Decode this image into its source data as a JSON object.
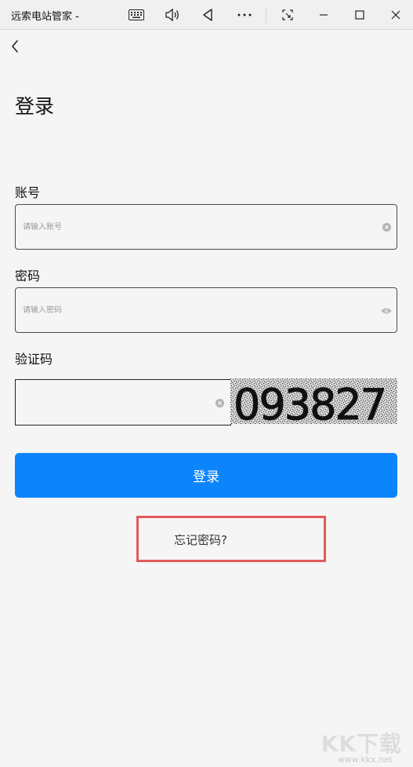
{
  "window": {
    "title": "远索电站管家 -"
  },
  "page": {
    "heading": "登录",
    "account": {
      "label": "账号",
      "placeholder": "请输入账号",
      "value": ""
    },
    "password": {
      "label": "密码",
      "placeholder": "请输入密码",
      "value": ""
    },
    "captcha": {
      "label": "验证码",
      "value": "",
      "image_text": "093827"
    },
    "login_button": "登录",
    "forgot_link": "忘记密码?"
  },
  "watermark": {
    "text": "KK下载",
    "url": "www.kkx.net"
  },
  "colors": {
    "accent": "#0c85fb",
    "highlight_box": "#e35a5a",
    "background": "#f5f5f5"
  },
  "icons": [
    "keyboard-icon",
    "speaker-icon",
    "back-triangle-icon",
    "more-icon",
    "snip-icon",
    "minimize-icon",
    "maximize-icon",
    "close-icon",
    "back-arrow-icon",
    "clear-icon",
    "eye-icon"
  ]
}
